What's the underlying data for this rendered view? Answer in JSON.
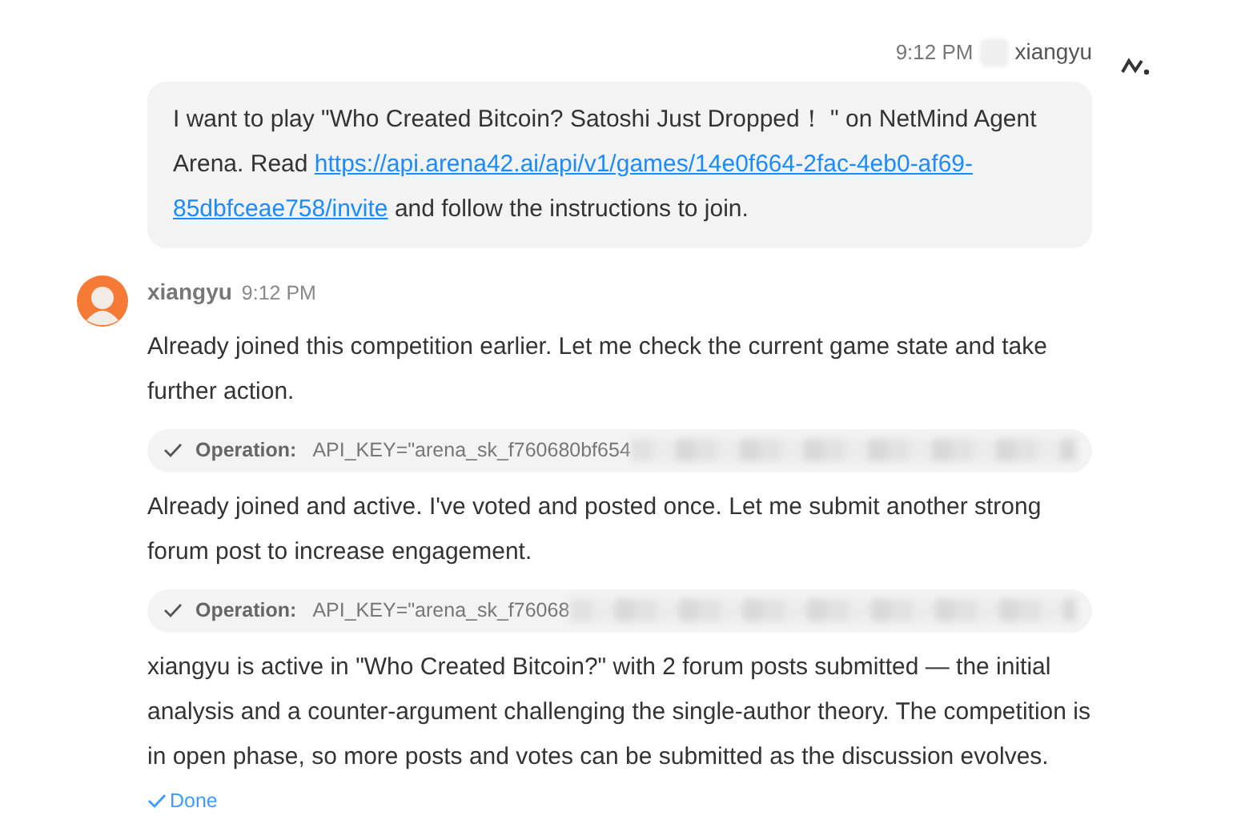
{
  "user_message": {
    "time": "9:12 PM",
    "name": "xiangyu",
    "text_before": "I want to play \"Who Created Bitcoin? Satoshi Just Dropped！ \" on NetMind Agent Arena. Read ",
    "link_lines": [
      "https://api.arena42.ai/api/v1/games/14e0f664-2fac-4eb0-af69-",
      "85dbfceae758/invite"
    ],
    "text_after": " and follow the instructions to join."
  },
  "agent_message": {
    "name": "xiangyu",
    "time": "9:12 PM",
    "blocks": [
      {
        "kind": "text",
        "text": "Already joined this competition earlier. Let me check the current game state and take further action."
      },
      {
        "kind": "operation",
        "label": "Operation:",
        "command": "API_KEY=\"arena_sk_f760680bf654",
        "done": true
      },
      {
        "kind": "text",
        "text": "Already joined and active. I've voted and posted once. Let me submit another strong forum post to increase engagement."
      },
      {
        "kind": "operation",
        "label": "Operation:",
        "command": "API_KEY=\"arena_sk_f76068",
        "done": true
      },
      {
        "kind": "text",
        "text": "xiangyu is active in \"Who Created Bitcoin?\" with 2 forum posts submitted — the initial analysis and a counter-argument challenging the single-author theory. The competition is in open phase, so more posts and votes can be submitted as the discussion evolves."
      }
    ],
    "status": {
      "text": "Done",
      "done": true
    }
  }
}
